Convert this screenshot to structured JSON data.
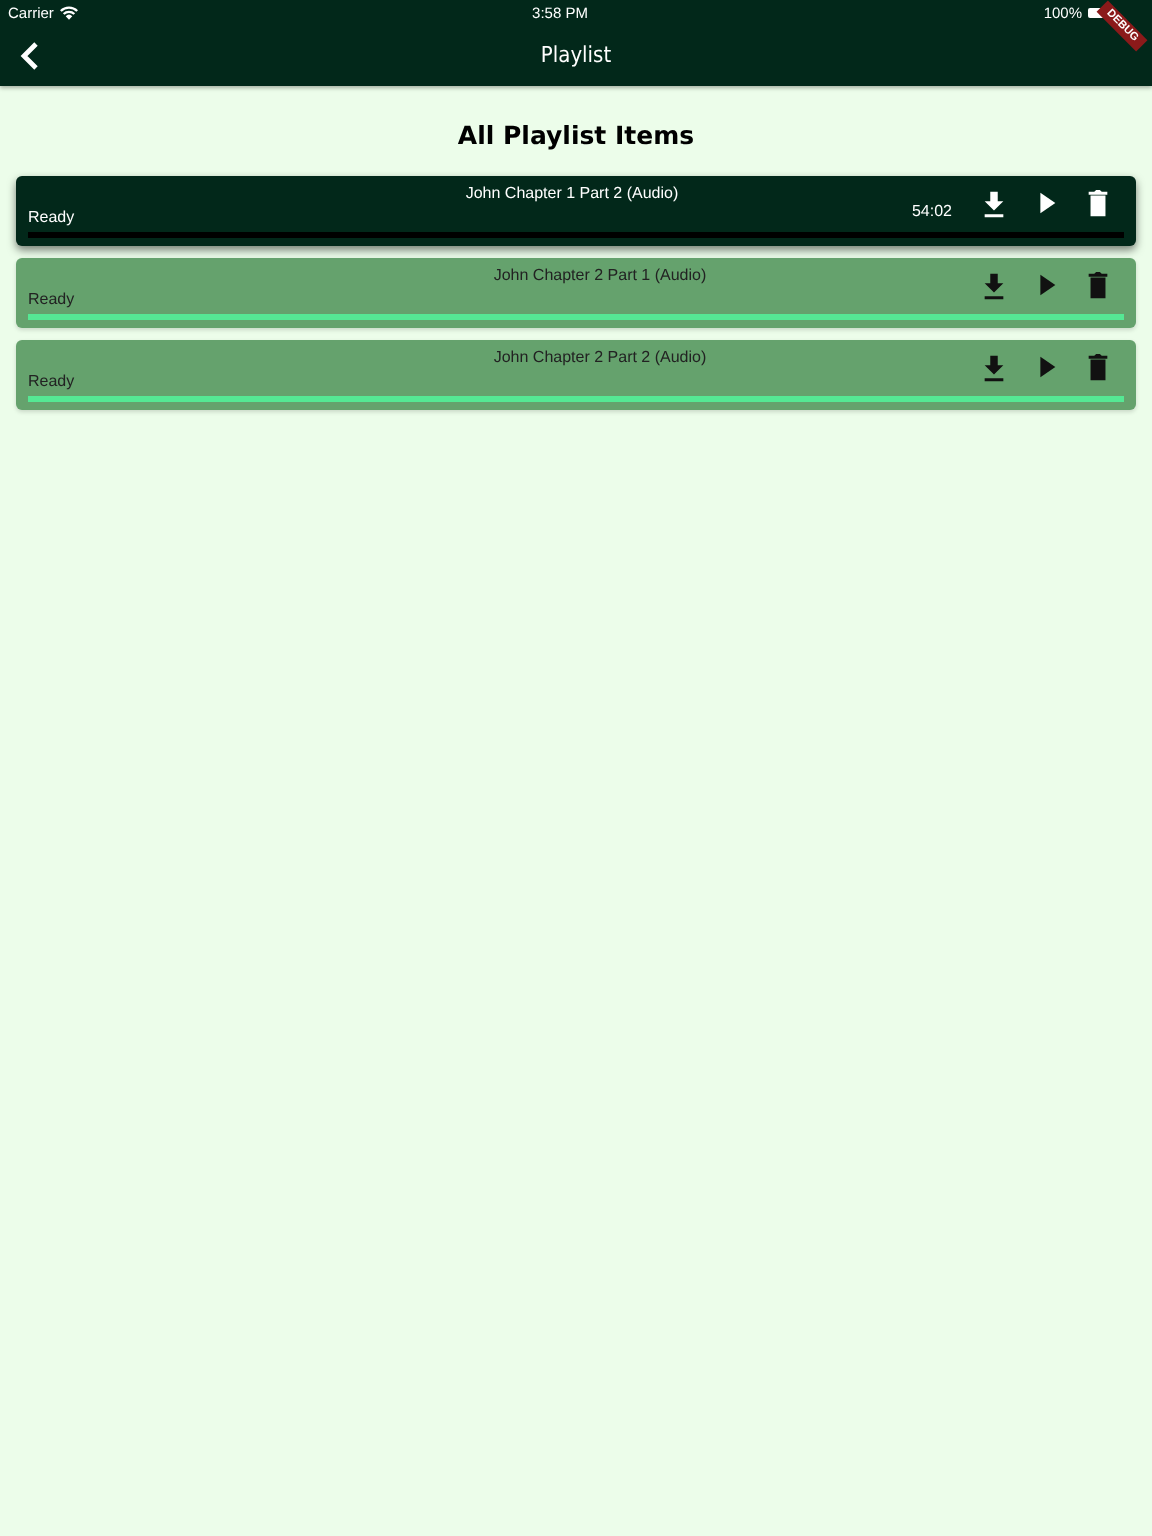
{
  "status_bar": {
    "carrier": "Carrier",
    "time": "3:58 PM",
    "battery": "100%"
  },
  "debug_banner": "DEBUG",
  "nav": {
    "title": "Playlist"
  },
  "heading": "All Playlist Items",
  "items": [
    {
      "title": "John Chapter 1 Part 2 (Audio)",
      "status": "Ready",
      "duration": "54:02",
      "selected": true,
      "level": 0
    },
    {
      "title": "John Chapter 2 Part 1 (Audio)",
      "status": "Ready",
      "selected": false,
      "level": 1
    },
    {
      "title": "John Chapter 2 Part 2 (Audio)",
      "status": "Ready",
      "selected": false,
      "level": 1
    }
  ]
}
